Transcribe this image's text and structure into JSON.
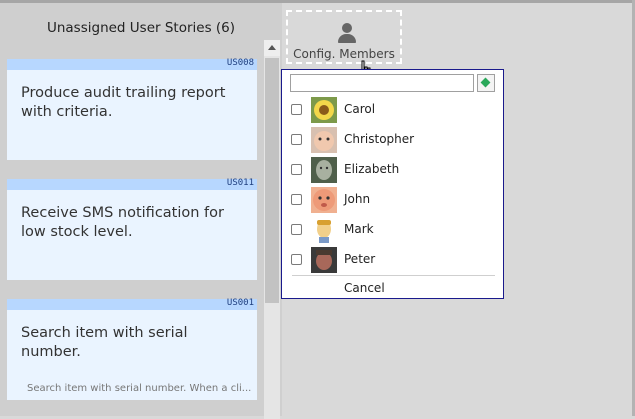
{
  "panel": {
    "title": "Unassigned User Stories (6)"
  },
  "stories": [
    {
      "id": "US008",
      "text": "Produce audit trailing report with criteria.",
      "desc": ""
    },
    {
      "id": "US011",
      "text": "Receive SMS notification for low stock level.",
      "desc": ""
    },
    {
      "id": "US001",
      "text": "Search item with serial number.",
      "desc": "Search item with serial number. When a cli..."
    }
  ],
  "config": {
    "label": "Config. Members"
  },
  "dropdown": {
    "search_value": "",
    "members": [
      {
        "name": "Carol",
        "avatar": "sunflower-avatar",
        "color": "#e8d86a"
      },
      {
        "name": "Christopher",
        "avatar": "baby-avatar",
        "color": "#e0b8a0"
      },
      {
        "name": "Elizabeth",
        "avatar": "statue-avatar",
        "color": "#6f7f6a"
      },
      {
        "name": "John",
        "avatar": "cartoon-face-avatar",
        "color": "#e89a7a"
      },
      {
        "name": "Mark",
        "avatar": "cartoon-man-avatar",
        "color": "#f0d080"
      },
      {
        "name": "Peter",
        "avatar": "man-photo-avatar",
        "color": "#8a5a4a"
      }
    ],
    "cancel_label": "Cancel"
  }
}
